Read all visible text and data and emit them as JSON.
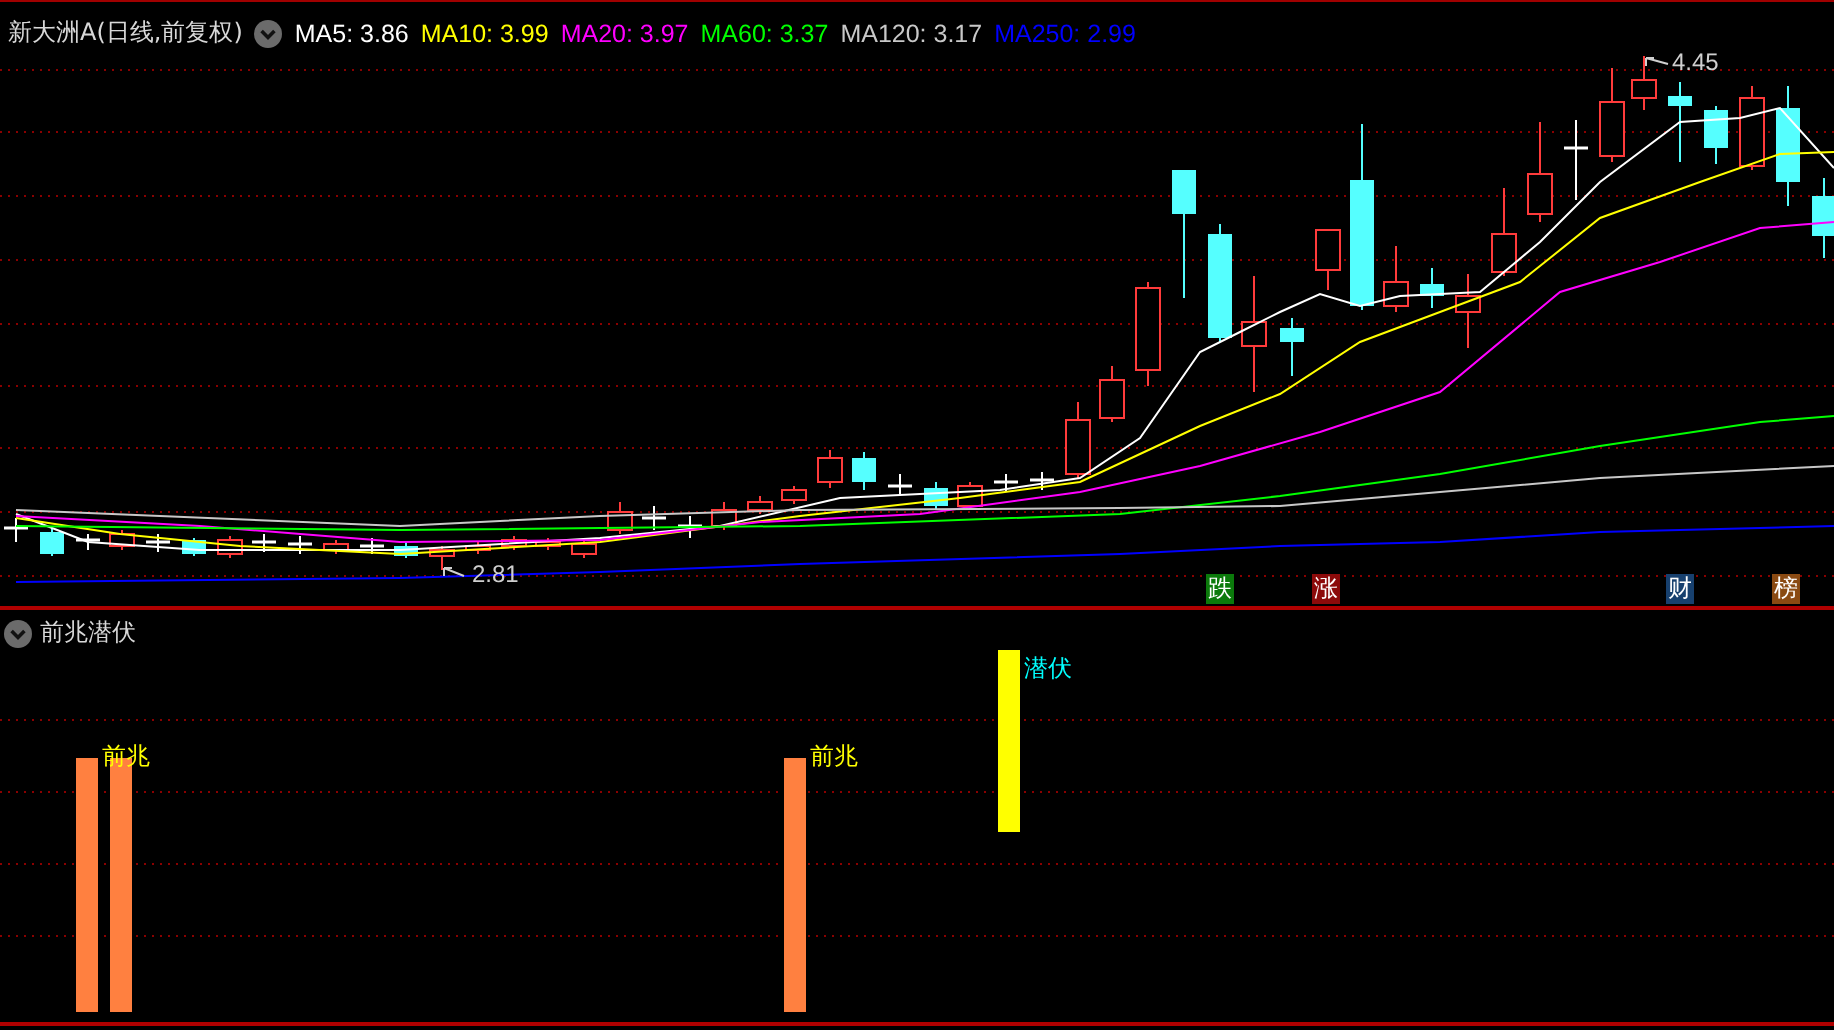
{
  "title": "新大洲A(日线,前复权)",
  "ma_legend": [
    {
      "label": "MA5: 3.86",
      "color": "#ffffff"
    },
    {
      "label": "MA10: 3.99",
      "color": "#ffff00"
    },
    {
      "label": "MA20: 3.97",
      "color": "#ff00ff"
    },
    {
      "label": "MA60: 3.37",
      "color": "#00ff00"
    },
    {
      "label": "MA120: 3.17",
      "color": "#c8c8c8"
    },
    {
      "label": "MA250: 2.99",
      "color": "#0000ff"
    }
  ],
  "price_labels": [
    {
      "kind": "high",
      "text": "4.45"
    },
    {
      "kind": "low",
      "text": "2.81"
    }
  ],
  "event_markers": [
    {
      "text": "跌",
      "color": "#0b7a0b"
    },
    {
      "text": "涨",
      "color": "#8c0a0a"
    },
    {
      "text": "财",
      "color": "#17406e"
    },
    {
      "text": "榜",
      "color": "#8a4a12"
    }
  ],
  "indicator_panel": {
    "title": "前兆潜伏",
    "signals": [
      {
        "kind": "omen",
        "label": "前兆"
      },
      {
        "kind": "omen",
        "label": "前兆"
      },
      {
        "kind": "lurk",
        "label": "潜伏"
      }
    ]
  }
}
